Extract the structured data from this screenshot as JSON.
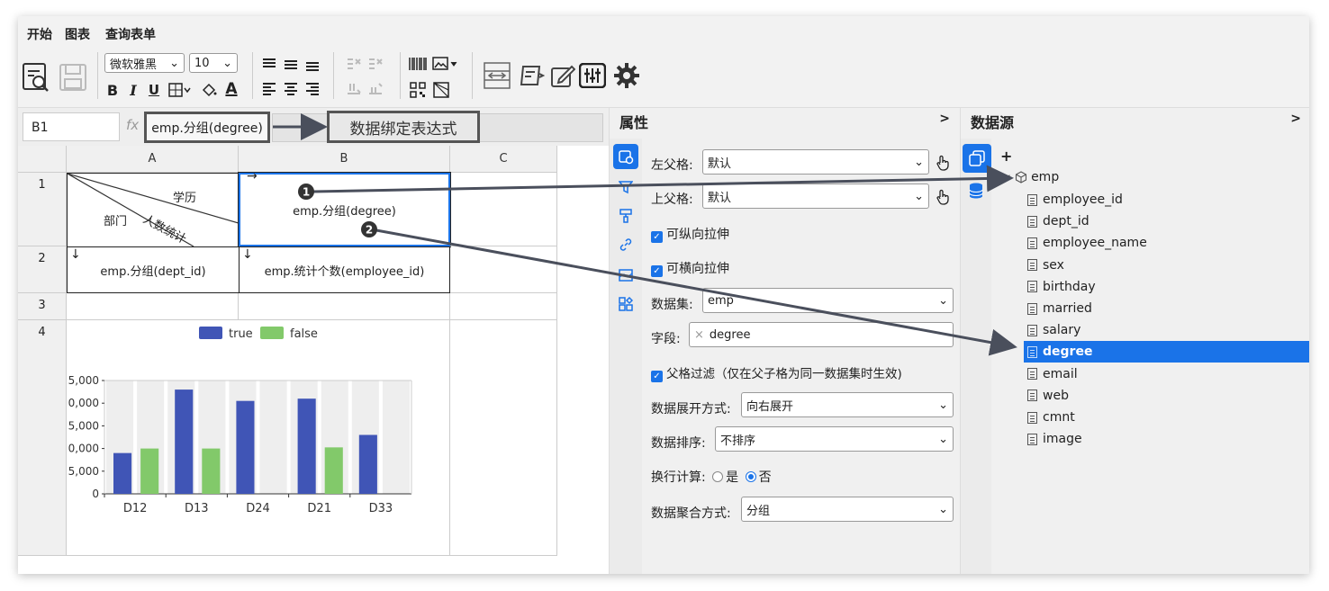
{
  "tabs": [
    "开始",
    "图表",
    "查询表单"
  ],
  "toolbar": {
    "font_family": "微软雅黑",
    "font_size": "10",
    "bold": "B",
    "italic": "I",
    "underline": "U",
    "font_color": "A"
  },
  "formula": {
    "cell_ref": "B1",
    "fx": "fx",
    "expression": "emp.分组(degree)",
    "callout": "数据绑定表达式"
  },
  "grid": {
    "columns": [
      "A",
      "B",
      "C"
    ],
    "rows": [
      "1",
      "2",
      "3",
      "4"
    ],
    "a1_top": "学历",
    "a1_mid": "人数统计",
    "a1_left": "部门",
    "b1_arrow": "→",
    "b1": "emp.分组(degree)",
    "a2_arrow": "↓",
    "a2": "emp.分组(dept_id)",
    "b2_arrow": "↓",
    "b2": "emp.统计个数(employee_id)"
  },
  "chart_data": {
    "type": "bar",
    "categories": [
      "D12",
      "D13",
      "D24",
      "D21",
      "D33"
    ],
    "series": [
      {
        "name": "true",
        "values": [
          1800,
          4600,
          4100,
          4200,
          2600
        ],
        "color": "#4055b6"
      },
      {
        "name": "false",
        "values": [
          2000,
          2000,
          null,
          2050,
          null
        ],
        "color": "#82c96a"
      }
    ],
    "y_ticks": [
      "0",
      "5,000",
      "0,000",
      "5,000",
      "0,000",
      "5,000"
    ],
    "ylim": [
      0,
      5000
    ],
    "legend": "top-center",
    "grid": "alternating-bands"
  },
  "properties": {
    "title": "属性",
    "collapse": ">",
    "left_parent_label": "左父格:",
    "left_parent_value": "默认",
    "top_parent_label": "上父格:",
    "top_parent_value": "默认",
    "v_stretch": "可纵向拉伸",
    "h_stretch": "可横向拉伸",
    "dataset_label": "数据集:",
    "dataset_value": "emp",
    "field_label": "字段:",
    "field_value": "degree",
    "field_clear": "×",
    "parent_filter": "父格过滤（仅在父子格为同一数据集时生效)",
    "expand_label": "数据展开方式:",
    "expand_value": "向右展开",
    "sort_label": "数据排序:",
    "sort_value": "不排序",
    "wrap_label": "换行计算:",
    "wrap_yes": "是",
    "wrap_no": "否",
    "agg_label": "数据聚合方式:",
    "agg_value": "分组"
  },
  "datasource": {
    "title": "数据源",
    "collapse": ">",
    "add": "+",
    "root": "emp",
    "fields": [
      "employee_id",
      "dept_id",
      "employee_name",
      "sex",
      "birthday",
      "married",
      "salary",
      "degree",
      "email",
      "web",
      "cmnt",
      "image"
    ],
    "selected": "degree"
  },
  "markers": [
    "1",
    "2"
  ]
}
